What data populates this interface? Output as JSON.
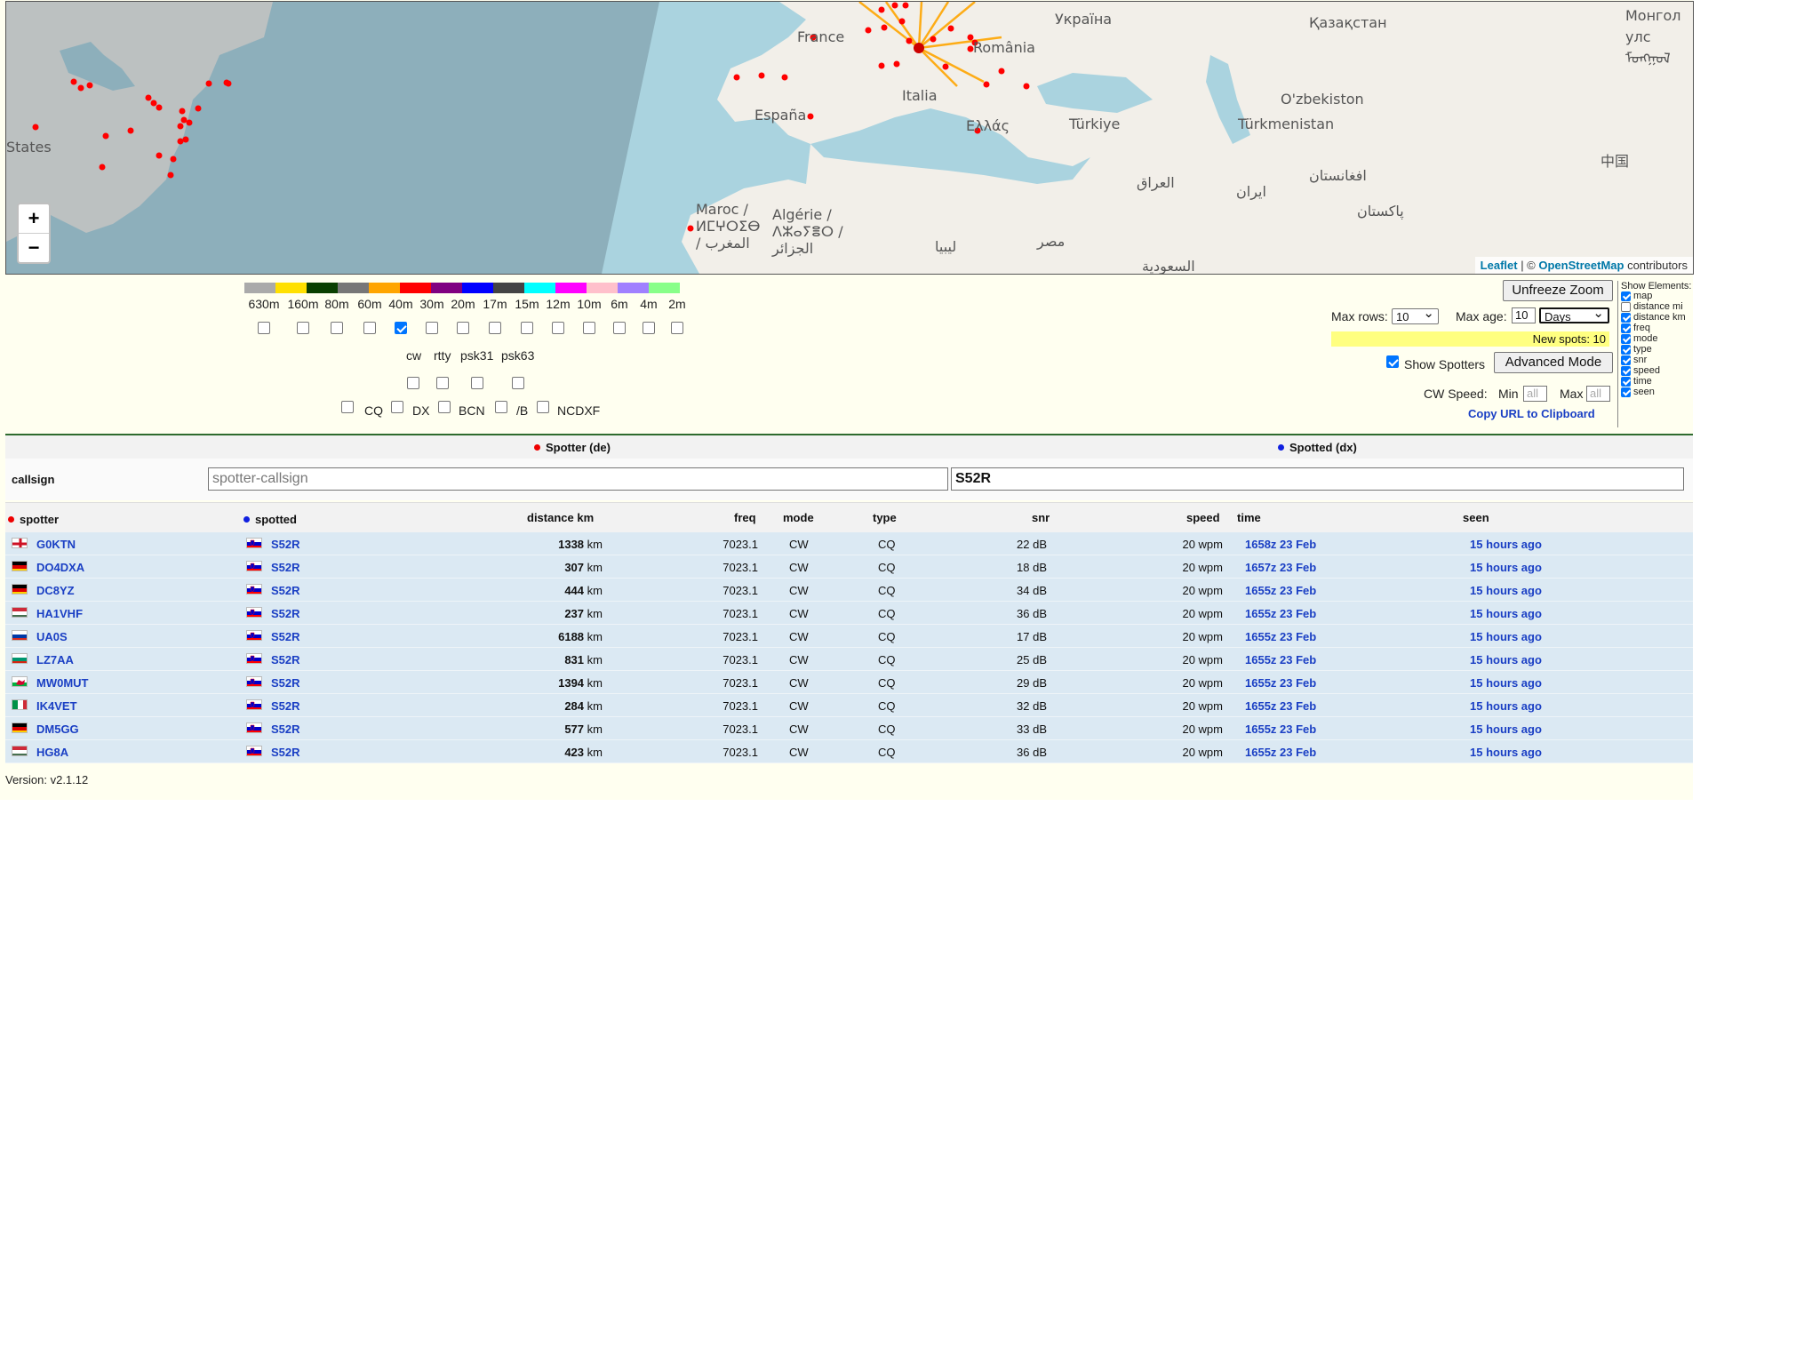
{
  "map": {
    "labels": [
      "States",
      "France",
      "España",
      "Italia",
      "România",
      "Ελλάς",
      "Türkiye",
      "Україна",
      "Қазақстан",
      "O'zbekiston",
      "Türkmenistan",
      "Maroc / ⵍⵎⵖⵔⵉⴱ / المغرب",
      "Algérie / ⴷⵣⴰⵢⴻⵔ / الجزائر",
      "ليبيا",
      "مصر",
      "السعودية",
      "العراق",
      "ایران",
      "افغانستان",
      "پاکستان",
      "中国",
      "Монгол улс ᠮᠣᠩᠭᠣᠯ"
    ],
    "zoom_in": "+",
    "zoom_out": "−",
    "attribution": {
      "leaflet": "Leaflet",
      "sep": " | © ",
      "osm": "OpenStreetMap",
      "suffix": " contributors"
    },
    "spot_color": "#ff0000",
    "path_color": "#ffa500"
  },
  "bands": [
    {
      "label": "630m",
      "color": "#aaaaaa",
      "checked": false
    },
    {
      "label": "160m",
      "color": "#ffe000",
      "checked": false
    },
    {
      "label": "80m",
      "color": "#093f00",
      "checked": false
    },
    {
      "label": "60m",
      "color": "#777777",
      "checked": false
    },
    {
      "label": "40m",
      "color": "#ffa500",
      "checked": true
    },
    {
      "label": "30m",
      "color": "#ff0000",
      "checked": false
    },
    {
      "label": "20m",
      "color": "#800080",
      "checked": false
    },
    {
      "label": "17m",
      "color": "#0000ff",
      "checked": false
    },
    {
      "label": "15m",
      "color": "#444444",
      "checked": false
    },
    {
      "label": "12m",
      "color": "#00ffff",
      "checked": false
    },
    {
      "label": "10m",
      "color": "#ff00ff",
      "checked": false
    },
    {
      "label": "6m",
      "color": "#ffc0cb",
      "checked": false
    },
    {
      "label": "4m",
      "color": "#a080ff",
      "checked": false
    },
    {
      "label": "2m",
      "color": "#88ff88",
      "checked": false
    }
  ],
  "modes": [
    "cw",
    "rtty",
    "psk31",
    "psk63"
  ],
  "types": [
    "CQ",
    "DX",
    "BCN",
    "/B",
    "NCDXF"
  ],
  "controls": {
    "unfreeze_zoom": "Unfreeze Zoom",
    "max_rows_label": "Max rows:",
    "max_rows_value": "10",
    "max_age_label": "Max age:",
    "max_age_value": "10",
    "max_age_unit": "Days",
    "new_spots": "New spots: 10",
    "show_spotters": "Show Spotters",
    "show_spotters_checked": true,
    "advanced_mode": "Advanced Mode",
    "cw_speed_label": "CW Speed:",
    "min_label": "Min",
    "min_placeholder": "all",
    "max_label": "Max",
    "max_placeholder": "all",
    "copy_url": "Copy URL to Clipboard"
  },
  "show_elements": {
    "title": "Show Elements:",
    "items": [
      {
        "label": "map",
        "checked": true
      },
      {
        "label": "distance mi",
        "checked": false
      },
      {
        "label": "distance km",
        "checked": true
      },
      {
        "label": "freq",
        "checked": true
      },
      {
        "label": "mode",
        "checked": true
      },
      {
        "label": "type",
        "checked": true
      },
      {
        "label": "snr",
        "checked": true
      },
      {
        "label": "speed",
        "checked": true
      },
      {
        "label": "time",
        "checked": true
      },
      {
        "label": "seen",
        "checked": true
      }
    ]
  },
  "table": {
    "spotter_de": "Spotter (de)",
    "spotted_dx": "Spotted (dx)",
    "callsign_label": "callsign",
    "spotter_placeholder": "spotter-callsign",
    "spotted_value": "S52R",
    "columns": {
      "spotter": "spotter",
      "spotted": "spotted",
      "distance": "distance km",
      "freq": "freq",
      "mode": "mode",
      "type": "type",
      "snr": "snr",
      "speed": "speed",
      "time": "time",
      "seen": "seen"
    },
    "km_unit": "km",
    "rows": [
      {
        "spotter": "G0KTN",
        "spotter_flag": "eng",
        "spotted": "S52R",
        "distance": "1338",
        "freq": "7023.1",
        "mode": "CW",
        "type": "CQ",
        "snr": "22 dB",
        "speed": "20 wpm",
        "time": "1658z 23 Feb",
        "seen": "15 hours ago"
      },
      {
        "spotter": "DO4DXA",
        "spotter_flag": "de",
        "spotted": "S52R",
        "distance": "307",
        "freq": "7023.1",
        "mode": "CW",
        "type": "CQ",
        "snr": "18 dB",
        "speed": "20 wpm",
        "time": "1657z 23 Feb",
        "seen": "15 hours ago"
      },
      {
        "spotter": "DC8YZ",
        "spotter_flag": "de",
        "spotted": "S52R",
        "distance": "444",
        "freq": "7023.1",
        "mode": "CW",
        "type": "CQ",
        "snr": "34 dB",
        "speed": "20 wpm",
        "time": "1655z 23 Feb",
        "seen": "15 hours ago"
      },
      {
        "spotter": "HA1VHF",
        "spotter_flag": "hu",
        "spotted": "S52R",
        "distance": "237",
        "freq": "7023.1",
        "mode": "CW",
        "type": "CQ",
        "snr": "36 dB",
        "speed": "20 wpm",
        "time": "1655z 23 Feb",
        "seen": "15 hours ago"
      },
      {
        "spotter": "UA0S",
        "spotter_flag": "ru",
        "spotted": "S52R",
        "distance": "6188",
        "freq": "7023.1",
        "mode": "CW",
        "type": "CQ",
        "snr": "17 dB",
        "speed": "20 wpm",
        "time": "1655z 23 Feb",
        "seen": "15 hours ago"
      },
      {
        "spotter": "LZ7AA",
        "spotter_flag": "bg",
        "spotted": "S52R",
        "distance": "831",
        "freq": "7023.1",
        "mode": "CW",
        "type": "CQ",
        "snr": "25 dB",
        "speed": "20 wpm",
        "time": "1655z 23 Feb",
        "seen": "15 hours ago"
      },
      {
        "spotter": "MW0MUT",
        "spotter_flag": "wal",
        "spotted": "S52R",
        "distance": "1394",
        "freq": "7023.1",
        "mode": "CW",
        "type": "CQ",
        "snr": "29 dB",
        "speed": "20 wpm",
        "time": "1655z 23 Feb",
        "seen": "15 hours ago"
      },
      {
        "spotter": "IK4VET",
        "spotter_flag": "it",
        "spotted": "S52R",
        "distance": "284",
        "freq": "7023.1",
        "mode": "CW",
        "type": "CQ",
        "snr": "32 dB",
        "speed": "20 wpm",
        "time": "1655z 23 Feb",
        "seen": "15 hours ago"
      },
      {
        "spotter": "DM5GG",
        "spotter_flag": "de",
        "spotted": "S52R",
        "distance": "577",
        "freq": "7023.1",
        "mode": "CW",
        "type": "CQ",
        "snr": "33 dB",
        "speed": "20 wpm",
        "time": "1655z 23 Feb",
        "seen": "15 hours ago"
      },
      {
        "spotter": "HG8A",
        "spotter_flag": "hu",
        "spotted": "S52R",
        "distance": "423",
        "freq": "7023.1",
        "mode": "CW",
        "type": "CQ",
        "snr": "36 dB",
        "speed": "20 wpm",
        "time": "1655z 23 Feb",
        "seen": "15 hours ago"
      }
    ]
  },
  "version": "Version: v2.1.12"
}
